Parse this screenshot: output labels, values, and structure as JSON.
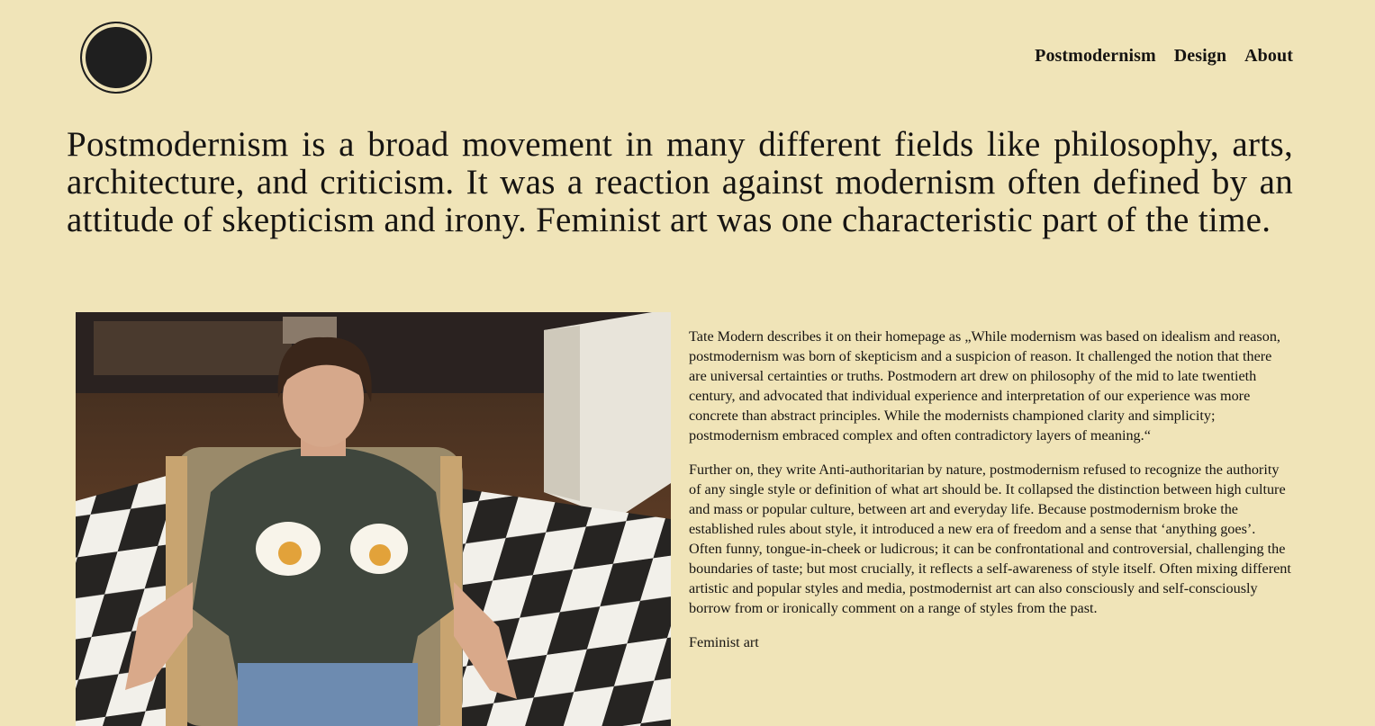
{
  "header": {
    "logo_icon": "circle-logo",
    "nav": [
      {
        "label": "Postmodernism"
      },
      {
        "label": "Design"
      },
      {
        "label": "About"
      }
    ]
  },
  "headline": "Postmodernism is a broad movement in many different fields like philosophy, arts, architecture, and criticism. It was a reaction against modernism often defined by an attitude of skepticism and irony. Feminist art was one characteristic part of the time.",
  "article": {
    "paragraphs": [
      "Tate Modern describes it on their homepage as „While modernism was based on idealism and reason, postmodernism was born of skepticism and a suspicion of reason. It challenged the notion that there are universal certainties or truths. Postmodern art drew on philosophy of the mid to late twentieth century, and advocated that individual experience and interpretation of our experience was more concrete than abstract principles. While the modernists championed clarity and simplicity; postmodernism embraced complex and often contradictory layers of meaning.“",
      "Further on, they write Anti-authoritarian by nature, postmodernism refused to recognize the authority of any single style or definition of what art should be. It collapsed the distinction between high culture and mass or popular culture, between art and everyday life. Because postmodernism broke the established rules about style, it introduced a new era of freedom and a sense that ‘anything goes’. Often funny, tongue-in-cheek or ludicrous; it can be confrontational and controversial, challenging the boundaries of taste; but most crucially, it reflects a self-awareness of style itself. Often mixing different artistic and popular styles and media, postmodernist art can also consciously and self-consciously borrow from or ironically comment on a range of styles from the past.",
      "Feminist art"
    ]
  },
  "colors": {
    "background": "#f0e4b8",
    "text": "#161412",
    "logo": "#1f1f1f"
  }
}
